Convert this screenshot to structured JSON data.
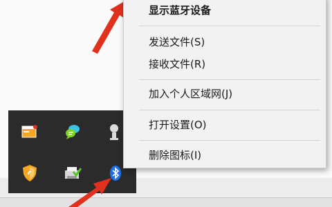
{
  "context_menu": {
    "items": [
      {
        "label": "显示蓝牙设备",
        "bold": true
      },
      {
        "label": "发送文件(S)"
      },
      {
        "label": "接收文件(R)"
      },
      {
        "label": "加入个人区域网(J)"
      },
      {
        "label": "打开设置(O)"
      },
      {
        "label": "删除图标(I)"
      }
    ]
  },
  "tray": {
    "icons": [
      {
        "name": "window-app-icon"
      },
      {
        "name": "chat-bubbles-icon"
      },
      {
        "name": "device-icon"
      },
      {
        "name": "shield-icon"
      },
      {
        "name": "printer-check-icon"
      },
      {
        "name": "bluetooth-icon"
      }
    ]
  },
  "colors": {
    "tray_bg": "#2b2b2b",
    "menu_bg": "#f2f2f2",
    "arrow_red": "#e0301e",
    "bluetooth_blue": "#1e6fe8"
  }
}
